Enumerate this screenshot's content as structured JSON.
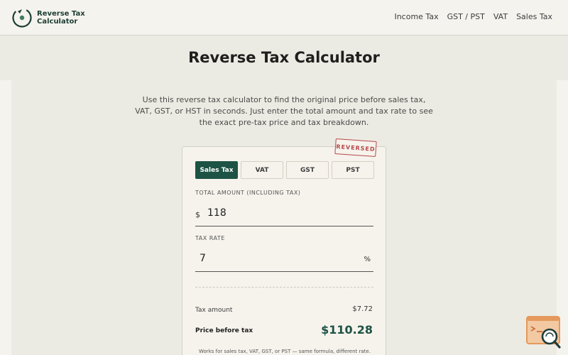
{
  "header": {
    "logo_line1": "Reverse Tax",
    "logo_line2": "Calculator",
    "nav": [
      "Income Tax",
      "GST / PST",
      "VAT",
      "Sales Tax"
    ]
  },
  "main": {
    "title": "Reverse Tax Calculator",
    "intro": "Use this reverse tax calculator to find the original price before sales tax, VAT, GST, or HST in seconds. Just enter the total amount and tax rate to see the exact pre-tax price and tax breakdown."
  },
  "calculator": {
    "stamp": "REVERSED",
    "tabs": [
      {
        "label": "Sales Tax",
        "active": true
      },
      {
        "label": "VAT",
        "active": false
      },
      {
        "label": "GST",
        "active": false
      },
      {
        "label": "PST",
        "active": false
      }
    ],
    "total_label": "TOTAL AMOUNT (INCLUDING TAX)",
    "currency_symbol": "$",
    "total_value": "118",
    "rate_label": "TAX RATE",
    "rate_value": "7",
    "rate_suffix": "%",
    "tax_amount_label": "Tax amount",
    "tax_amount_value": "$7.72",
    "price_before_label": "Price before tax",
    "price_before_value": "$110.28",
    "footnote": "Works for sales tax, VAT, GST, or PST — same formula, different rate."
  },
  "colors": {
    "accent": "#1d5344",
    "stamp": "#b5484a",
    "background": "#ecebe3"
  },
  "icons": [
    "logo-refresh-icon",
    "help-search-icon"
  ]
}
